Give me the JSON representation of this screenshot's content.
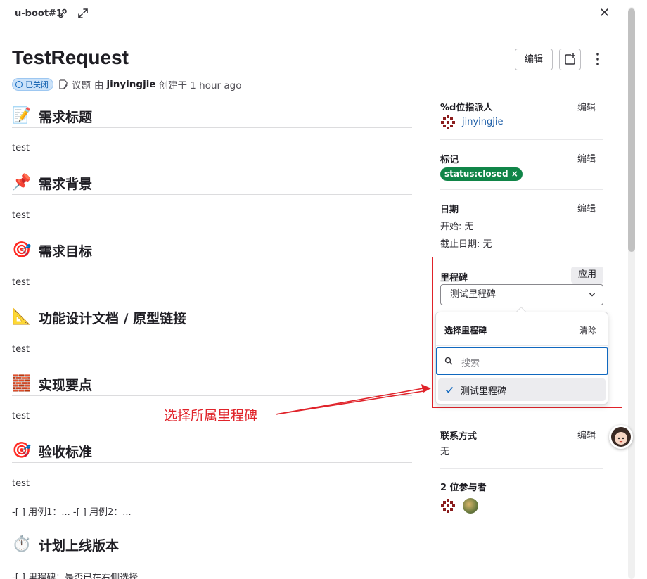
{
  "topbar": {
    "ref": "u-boot#1"
  },
  "issue": {
    "title": "TestRequest",
    "edit_label": "编辑",
    "status": "已关闭",
    "type": "议题",
    "by": "由",
    "author": "jinyingjie",
    "created": "创建于 1 hour ago"
  },
  "sections": [
    {
      "emoji": "📝",
      "heading": "需求标题",
      "body": "test"
    },
    {
      "emoji": "📌",
      "heading": "需求背景",
      "body": "test"
    },
    {
      "emoji": "🎯",
      "heading": "需求目标",
      "body": "test"
    },
    {
      "emoji": "📐",
      "heading": "功能设计文档 / 原型链接",
      "body": "test"
    },
    {
      "emoji": "🧱",
      "heading": "实现要点",
      "body": "test"
    },
    {
      "emoji": "🎯",
      "heading": "验收标准",
      "body": "test",
      "body2": "-[ ] 用例1：... -[ ] 用例2：..."
    },
    {
      "emoji": "⏱️",
      "heading": "计划上线版本",
      "body": "-[ ] 里程碑：是否已在右侧选择"
    }
  ],
  "sidebar": {
    "assignee_label": "%d位指派人",
    "assignee": "jinyingjie",
    "labels_label": "标记",
    "label_pill": "status:closed",
    "dates_label": "日期",
    "start": "开始:   无",
    "due": "截止日期: 无",
    "milestone_label": "里程碑",
    "apply": "应用",
    "milestone_value": "测试里程碑",
    "edit": "编辑",
    "contact_label": "联系方式",
    "contact_value": "无",
    "participants_label": "2 位参与者"
  },
  "dropdown": {
    "title": "选择里程碑",
    "clear": "清除",
    "search_placeholder": "搜索",
    "items": [
      {
        "label": "测试里程碑",
        "selected": true
      }
    ]
  },
  "annotation": {
    "text": "选择所属里程碑",
    "color": "#e0232a"
  },
  "colors": {
    "accent": "#1068bf",
    "label_green": "#108548",
    "annotation_red": "#e0232a"
  }
}
